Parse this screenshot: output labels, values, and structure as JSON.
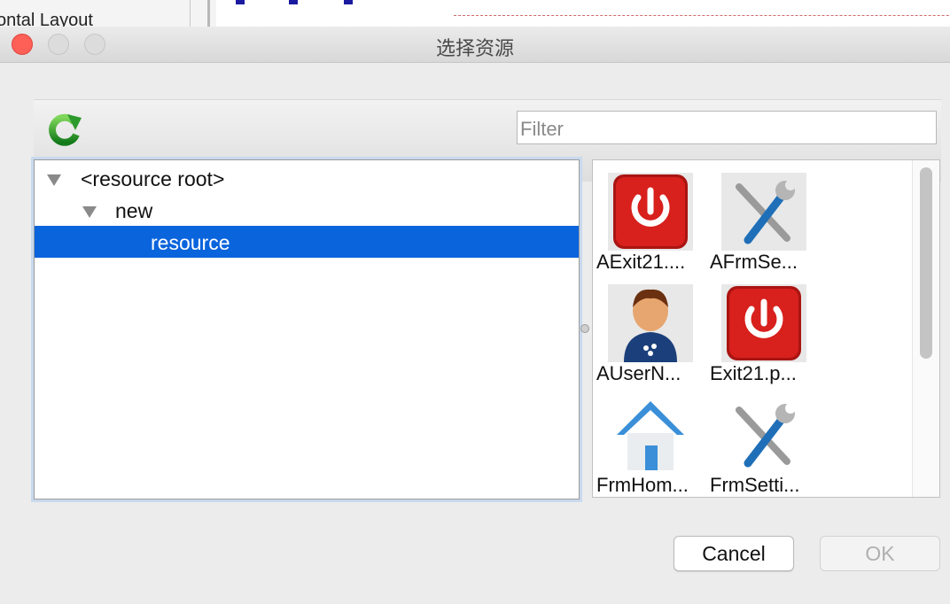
{
  "background_window": {
    "partial_label": "ontal Layout"
  },
  "dialog": {
    "title": "选择资源",
    "filter": {
      "placeholder": "Filter",
      "value": ""
    },
    "tree": [
      {
        "label": "<resource root>",
        "expanded": true
      },
      {
        "label": "new",
        "expanded": true
      },
      {
        "label": "resource",
        "selected": true
      }
    ],
    "resources": [
      {
        "caption": "AExit21....",
        "icon": "power-icon"
      },
      {
        "caption": "AFrmSe...",
        "icon": "tools-icon"
      },
      {
        "caption": "AUserN...",
        "icon": "user-icon"
      },
      {
        "caption": "Exit21.p...",
        "icon": "power-icon"
      },
      {
        "caption": "FrmHom...",
        "icon": "home-icon"
      },
      {
        "caption": "FrmSetti...",
        "icon": "tools-icon"
      }
    ],
    "buttons": {
      "cancel": "Cancel",
      "ok": "OK"
    }
  },
  "colors": {
    "selection": "#0a64dc",
    "close_light": "#fe5f57",
    "power_red": "#d8201c",
    "refresh_green": "#2c9a2c"
  }
}
